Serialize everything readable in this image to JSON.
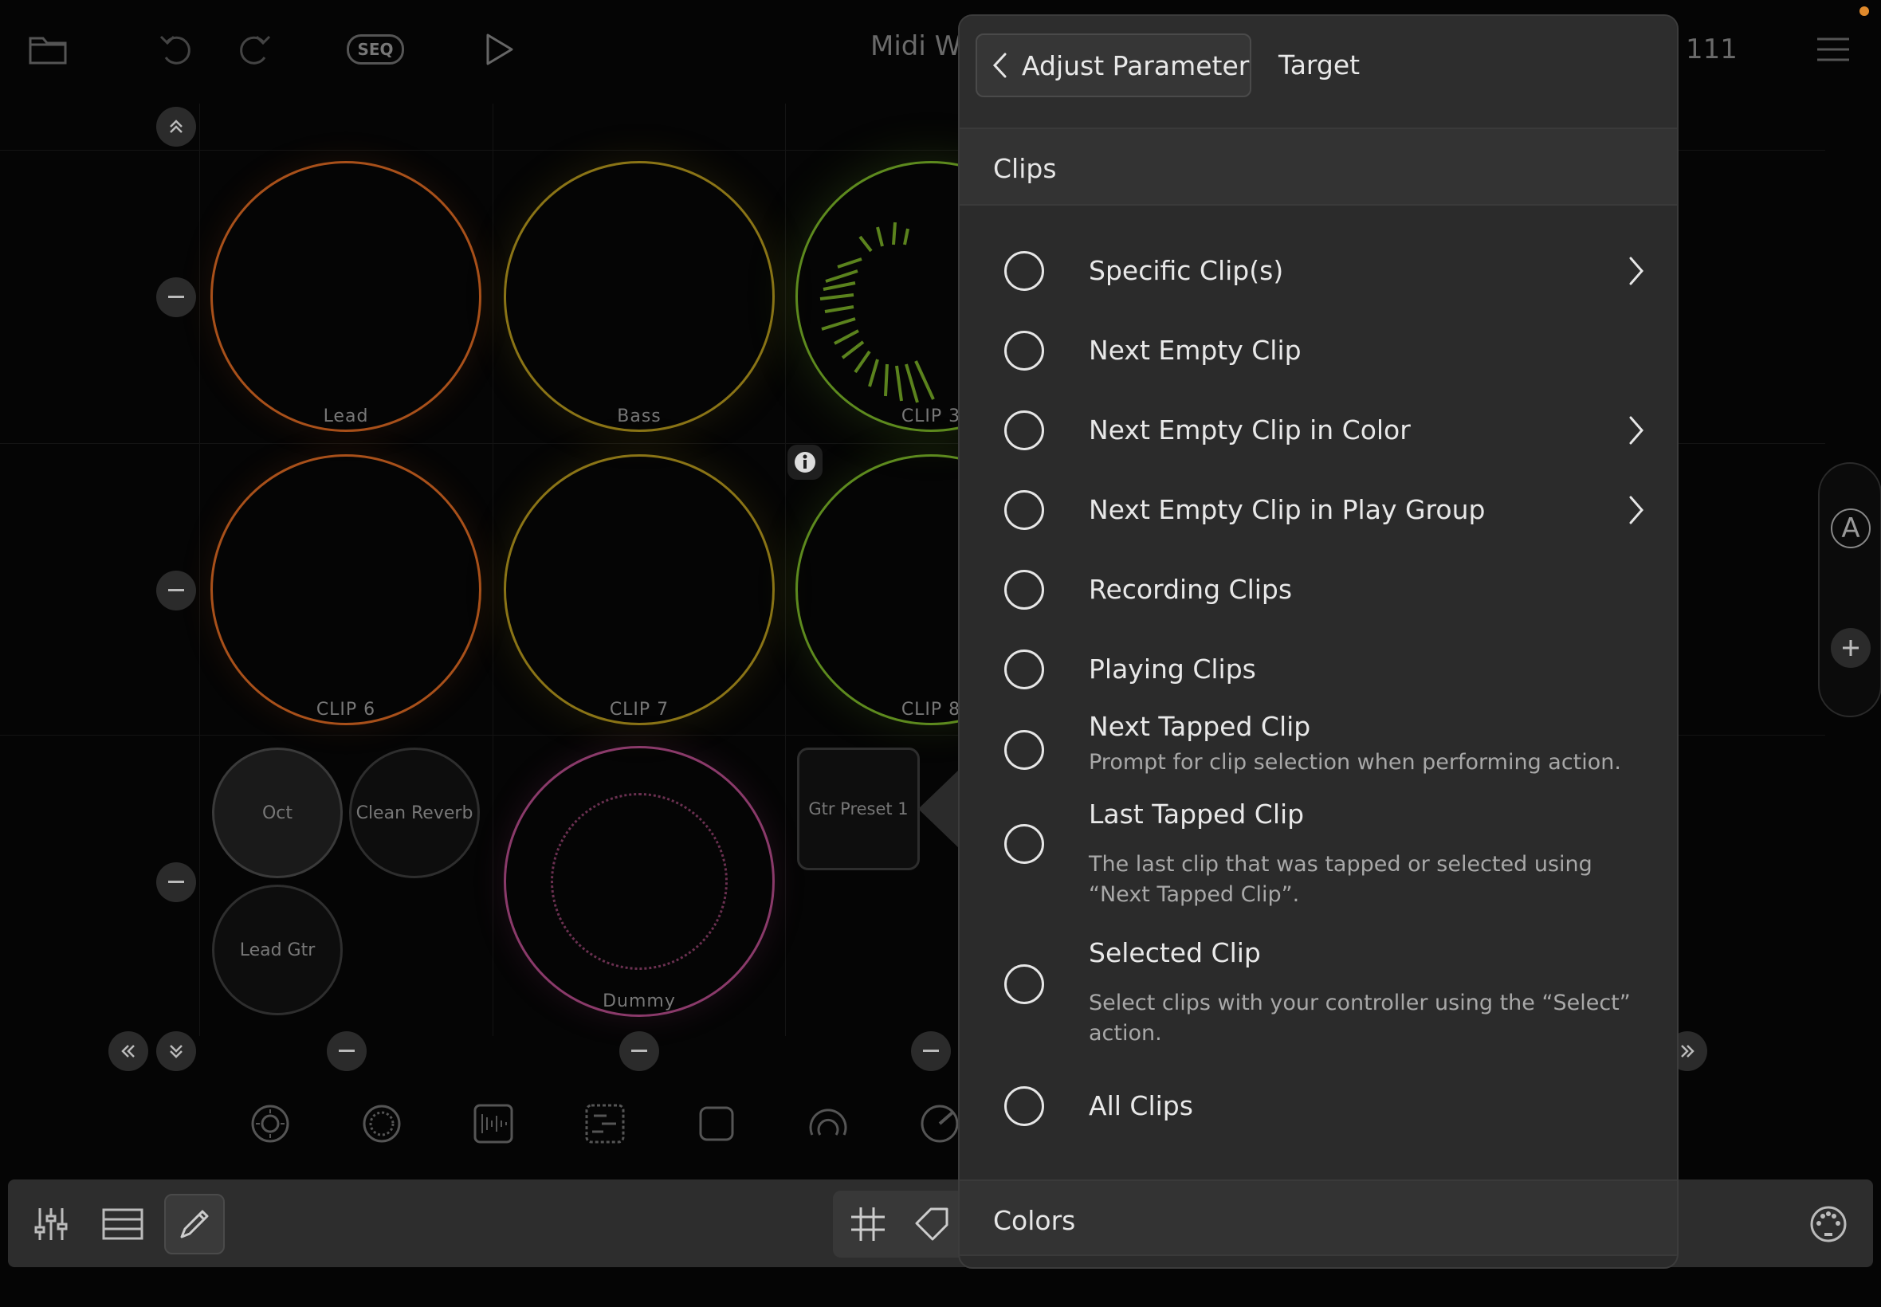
{
  "topbar": {
    "title": "Midi W",
    "tempo": "111",
    "seq_label": "SEQ"
  },
  "grid": {
    "clips": [
      {
        "label": "Lead",
        "color": "#a8501a"
      },
      {
        "label": "Bass",
        "color": "#8a7416"
      },
      {
        "label": "CLIP 3",
        "color": "#5d8a1e"
      },
      {
        "label": "CLIP 6",
        "color": "#a8501a"
      },
      {
        "label": "CLIP 7",
        "color": "#8a7416"
      },
      {
        "label": "CLIP 8",
        "color": "#5d8a1e"
      },
      {
        "label": "Dummy",
        "color": "#8a3a6a"
      }
    ],
    "small_clips": [
      "Oct",
      "Clean Reverb",
      "Lead Gtr"
    ],
    "preset": "Gtr Preset 1",
    "side_letter": "A"
  },
  "popover": {
    "back_label": "Adjust Parameter",
    "title": "Target",
    "sections": [
      {
        "label": "Clips"
      },
      {
        "label": "Colors"
      }
    ],
    "options": [
      {
        "label": "Specific Clip(s)",
        "desc": ""
      },
      {
        "label": "Next Empty Clip",
        "desc": ""
      },
      {
        "label": "Next Empty Clip in Color",
        "desc": ""
      },
      {
        "label": "Next Empty Clip in Play Group",
        "desc": ""
      },
      {
        "label": "Recording Clips",
        "desc": ""
      },
      {
        "label": "Playing Clips",
        "desc": ""
      },
      {
        "label": "Next Tapped Clip",
        "desc": "Prompt for clip selection when performing action."
      },
      {
        "label": "Last Tapped Clip",
        "desc": "The last clip that was tapped or selected using “Next Tapped Clip”."
      },
      {
        "label": "Selected Clip",
        "desc": "Select clips with your controller using the “Select” action."
      },
      {
        "label": "All Clips",
        "desc": ""
      }
    ]
  }
}
